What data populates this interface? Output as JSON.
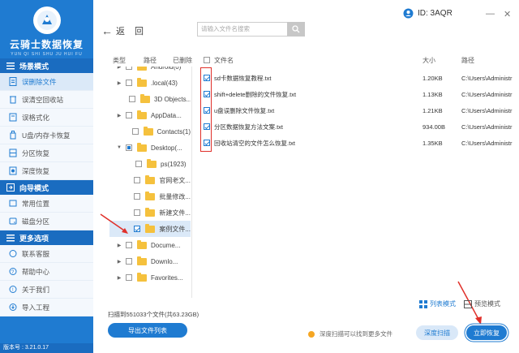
{
  "brand": {
    "title": "云骑士数据恢复",
    "subtitle": "YUN QI SHI SHU JU HUI FU"
  },
  "sidebar": {
    "sections": [
      {
        "label": "场景模式",
        "items": [
          {
            "label": "误删除文件",
            "active": true
          },
          {
            "label": "误清空回收站"
          },
          {
            "label": "误格式化"
          },
          {
            "label": "U盘/内存卡恢复"
          },
          {
            "label": "分区恢复"
          },
          {
            "label": "深度恢复"
          }
        ]
      },
      {
        "label": "向导模式",
        "items": [
          {
            "label": "常用位置"
          },
          {
            "label": "磁盘分区"
          }
        ]
      },
      {
        "label": "更多选项",
        "items": [
          {
            "label": "联系客服"
          },
          {
            "label": "帮助中心"
          },
          {
            "label": "关于我们"
          },
          {
            "label": "导入工程"
          }
        ]
      }
    ],
    "version": "版本号 : 3.21.0.17"
  },
  "topbar": {
    "back_label": "返",
    "home_label": "回",
    "search_placeholder": "请输入文件名搜索",
    "user_id": "ID: 3AQR"
  },
  "tree_header": {
    "type": "类型",
    "path": "路径",
    "deleted": "已删除"
  },
  "file_header": {
    "name": "文件名",
    "size": "大小",
    "path": "路径"
  },
  "tree": [
    {
      "label": "Android(0)",
      "tri": "▶",
      "cb": "none",
      "partial_row": true
    },
    {
      "label": ".local(43)",
      "tri": "▶",
      "cb": "none"
    },
    {
      "label": "3D Objects...",
      "tri": "",
      "cb": "none"
    },
    {
      "label": "AppData...",
      "tri": "▶",
      "cb": "none"
    },
    {
      "label": "Contacts(1)",
      "tri": "",
      "cb": "none"
    },
    {
      "label": "Desktop(...",
      "tri": "▼",
      "cb": "partial"
    },
    {
      "label": "ps(1923)",
      "tri": "",
      "cb": "none"
    },
    {
      "label": "官网老文...",
      "tri": "",
      "cb": "none"
    },
    {
      "label": "批量修改...",
      "tri": "",
      "cb": "none"
    },
    {
      "label": "新建文件...",
      "tri": "",
      "cb": "none"
    },
    {
      "label": "案例文件...",
      "tri": "",
      "cb": "checked",
      "selected": true
    },
    {
      "label": "Docume...",
      "tri": "▶",
      "cb": "none"
    },
    {
      "label": "Downlo...",
      "tri": "▶",
      "cb": "none"
    },
    {
      "label": "Favorites...",
      "tri": "▶",
      "cb": "none"
    }
  ],
  "files": [
    {
      "name": "sd卡数据恢复教程.txt",
      "size": "1.20KB",
      "path": "C:\\Users\\Administr"
    },
    {
      "name": "shift+delete删除的文件恢复.txt",
      "size": "1.13KB",
      "path": "C:\\Users\\Administr"
    },
    {
      "name": "u盘误删除文件恢复.txt",
      "size": "1.21KB",
      "path": "C:\\Users\\Administr"
    },
    {
      "name": "分区数据恢复方法文案.txt",
      "size": "934.00B",
      "path": "C:\\Users\\Administr"
    },
    {
      "name": "回收站清空的文件怎么恢复.txt",
      "size": "1.35KB",
      "path": "C:\\Users\\Administr"
    }
  ],
  "footer": {
    "scan_stats": "扫描到551033个文件(共63.23GB)",
    "export_label": "导出文件列表",
    "list_mode": "列表模式",
    "preview_mode": "预览模式",
    "hint": "深度扫描可以找到更多文件",
    "deep_scan": "深度扫描",
    "recover_now": "立即恢复"
  },
  "colors": {
    "primary": "#1f7bd1",
    "annotation": "#e0302a",
    "folder": "#f5c13d"
  }
}
